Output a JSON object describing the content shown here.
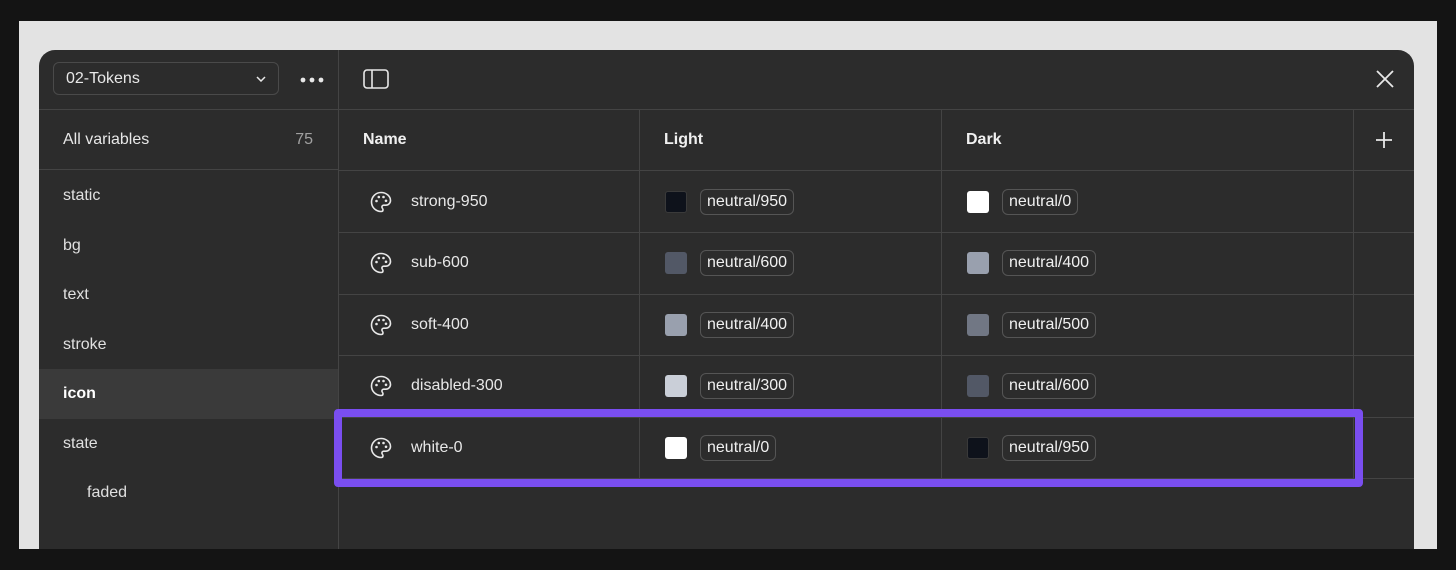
{
  "collection": {
    "selected": "02-Tokens"
  },
  "sidebar": {
    "all_variables_label": "All variables",
    "all_variables_count": "75",
    "groups": [
      {
        "label": "static"
      },
      {
        "label": "bg"
      },
      {
        "label": "text"
      },
      {
        "label": "stroke"
      },
      {
        "label": "icon",
        "active": true
      },
      {
        "label": "state"
      },
      {
        "label": "faded",
        "indent": true
      }
    ]
  },
  "table": {
    "headers": {
      "name": "Name",
      "light": "Light",
      "dark": "Dark"
    },
    "rows": [
      {
        "name": "strong-950",
        "light": {
          "value": "neutral/950",
          "color": "#0e121b"
        },
        "dark": {
          "value": "neutral/0",
          "color": "#ffffff"
        }
      },
      {
        "name": "sub-600",
        "light": {
          "value": "neutral/600",
          "color": "#525866"
        },
        "dark": {
          "value": "neutral/400",
          "color": "#99a0ae"
        }
      },
      {
        "name": "soft-400",
        "light": {
          "value": "neutral/400",
          "color": "#99a0ae"
        },
        "dark": {
          "value": "neutral/500",
          "color": "#717784"
        }
      },
      {
        "name": "disabled-300",
        "light": {
          "value": "neutral/300",
          "color": "#cacfd8"
        },
        "dark": {
          "value": "neutral/600",
          "color": "#525866"
        }
      },
      {
        "name": "white-0",
        "light": {
          "value": "neutral/0",
          "color": "#ffffff"
        },
        "dark": {
          "value": "neutral/950",
          "color": "#0e121b"
        }
      }
    ]
  },
  "highlight_color": "#7a4ef0"
}
